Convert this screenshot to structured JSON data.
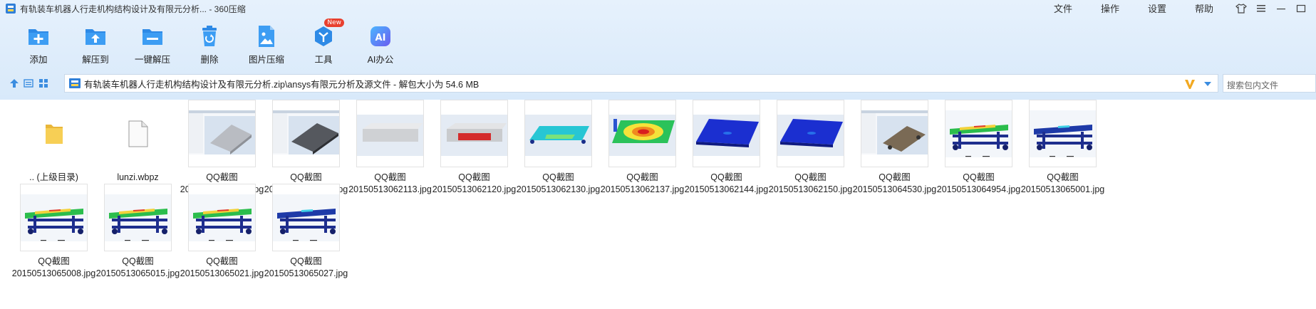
{
  "window": {
    "title": "有轨装车机器人行走机构结构设计及有限元分析... - 360压缩",
    "menu": [
      "文件",
      "操作",
      "设置",
      "帮助"
    ]
  },
  "toolbar": [
    {
      "label": "添加",
      "icon": "add-icon"
    },
    {
      "label": "解压到",
      "icon": "extract-to-icon"
    },
    {
      "label": "一键解压",
      "icon": "one-click-extract-icon"
    },
    {
      "label": "删除",
      "icon": "delete-icon"
    },
    {
      "label": "图片压缩",
      "icon": "image-compress-icon"
    },
    {
      "label": "工具",
      "icon": "tools-icon",
      "badge": "New"
    },
    {
      "label": "AI办公",
      "icon": "ai-office-icon"
    }
  ],
  "address": {
    "path": "有轨装车机器人行走机构结构设计及有限元分析.zip\\ansys有限元分析及源文件 - 解包大小为 54.6 MB",
    "search_placeholder": "搜索包内文件"
  },
  "files": [
    {
      "line1": ".. (上级目录)",
      "line2": "",
      "kind": "folder"
    },
    {
      "line1": "lunzi.wbpz",
      "line2": "",
      "kind": "file"
    },
    {
      "line1": "QQ截图",
      "line2": "20150513061237.jpg",
      "kind": "img",
      "style": "ui-grey"
    },
    {
      "line1": "QQ截图",
      "line2": "20150513061433.jpg",
      "kind": "img",
      "style": "ui-dark"
    },
    {
      "line1": "QQ截图",
      "line2": "20150513062113.jpg",
      "kind": "img",
      "style": "plain-grey"
    },
    {
      "line1": "QQ截图",
      "line2": "20150513062120.jpg",
      "kind": "img",
      "style": "red-beam"
    },
    {
      "line1": "QQ截图",
      "line2": "20150513062130.jpg",
      "kind": "img",
      "style": "cyan-plate"
    },
    {
      "line1": "QQ截图",
      "line2": "20150513062137.jpg",
      "kind": "img",
      "style": "contour"
    },
    {
      "line1": "QQ截图",
      "line2": "20150513062144.jpg",
      "kind": "img",
      "style": "blue-plate"
    },
    {
      "line1": "QQ截图",
      "line2": "20150513062150.jpg",
      "kind": "img",
      "style": "blue-plate"
    },
    {
      "line1": "QQ截图",
      "line2": "20150513064530.jpg",
      "kind": "img",
      "style": "ui-frame"
    },
    {
      "line1": "QQ截图",
      "line2": "20150513064954.jpg",
      "kind": "img",
      "style": "frame-color"
    },
    {
      "line1": "QQ截图",
      "line2": "20150513065001.jpg",
      "kind": "img",
      "style": "frame-blue"
    },
    {
      "line1": "QQ截图",
      "line2": "20150513065008.jpg",
      "kind": "img",
      "style": "frame-color"
    },
    {
      "line1": "QQ截图",
      "line2": "20150513065015.jpg",
      "kind": "img",
      "style": "frame-color"
    },
    {
      "line1": "QQ截图",
      "line2": "20150513065021.jpg",
      "kind": "img",
      "style": "frame-color"
    },
    {
      "line1": "QQ截图",
      "line2": "20150513065027.jpg",
      "kind": "img",
      "style": "frame-blue"
    }
  ],
  "colors": {
    "accent": "#2f8fe8",
    "top_bg": "#dceafb",
    "badge": "#e8402f"
  }
}
